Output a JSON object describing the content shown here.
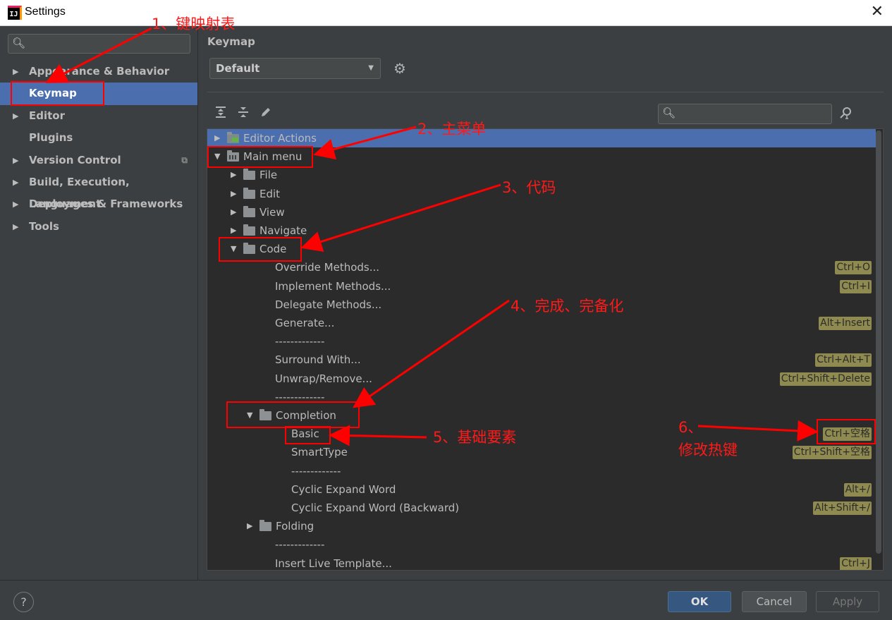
{
  "window": {
    "title": "Settings",
    "close_glyph": "✕",
    "app_icon": "IJ"
  },
  "sidebar": {
    "search_icon": "search-icon",
    "items": [
      {
        "label": "Appearance & Behavior",
        "has_arrow": true
      },
      {
        "label": "Keymap",
        "has_arrow": false,
        "selected": true
      },
      {
        "label": "Editor",
        "has_arrow": true
      },
      {
        "label": "Plugins",
        "has_arrow": false
      },
      {
        "label": "Version Control",
        "has_arrow": true
      },
      {
        "label": "Build, Execution, Deployment",
        "has_arrow": true
      },
      {
        "label": "Languages & Frameworks",
        "has_arrow": true
      },
      {
        "label": "Tools",
        "has_arrow": true
      }
    ]
  },
  "main": {
    "title": "Keymap",
    "keymap_value": "Default"
  },
  "tree": {
    "rows": [
      {
        "label": "Editor Actions",
        "level": 0,
        "expand": "right",
        "icon": "action",
        "selected": true,
        "shortcut": ""
      },
      {
        "label": "Main menu",
        "level": 0,
        "expand": "down",
        "icon": "menu",
        "shortcut": ""
      },
      {
        "label": "File",
        "level": 1,
        "expand": "right",
        "icon": "folder",
        "shortcut": ""
      },
      {
        "label": "Edit",
        "level": 1,
        "expand": "right",
        "icon": "folder",
        "shortcut": ""
      },
      {
        "label": "View",
        "level": 1,
        "expand": "right",
        "icon": "folder",
        "shortcut": ""
      },
      {
        "label": "Navigate",
        "level": 1,
        "expand": "right",
        "icon": "folder",
        "shortcut": ""
      },
      {
        "label": "Code",
        "level": 1,
        "expand": "down",
        "icon": "folder",
        "shortcut": ""
      },
      {
        "label": "Override Methods...",
        "level": 2,
        "expand": "",
        "icon": "",
        "shortcut": "Ctrl+O"
      },
      {
        "label": "Implement Methods...",
        "level": 2,
        "expand": "",
        "icon": "",
        "shortcut": "Ctrl+I"
      },
      {
        "label": "Delegate Methods...",
        "level": 2,
        "expand": "",
        "icon": "",
        "shortcut": ""
      },
      {
        "label": "Generate...",
        "level": 2,
        "expand": "",
        "icon": "",
        "shortcut": "Alt+Insert"
      },
      {
        "label": "-------------",
        "level": 2,
        "expand": "",
        "icon": "",
        "shortcut": ""
      },
      {
        "label": "Surround With...",
        "level": 2,
        "expand": "",
        "icon": "",
        "shortcut": "Ctrl+Alt+T"
      },
      {
        "label": "Unwrap/Remove...",
        "level": 2,
        "expand": "",
        "icon": "",
        "shortcut": "Ctrl+Shift+Delete"
      },
      {
        "label": "-------------",
        "level": 2,
        "expand": "",
        "icon": "",
        "shortcut": ""
      },
      {
        "label": "Completion",
        "level": 2,
        "expand": "down",
        "icon": "folder",
        "shortcut": ""
      },
      {
        "label": "Basic",
        "level": 3,
        "expand": "",
        "icon": "",
        "shortcut": "Ctrl+空格"
      },
      {
        "label": "SmartType",
        "level": 3,
        "expand": "",
        "icon": "",
        "shortcut": "Ctrl+Shift+空格"
      },
      {
        "label": "-------------",
        "level": 3,
        "expand": "",
        "icon": "",
        "shortcut": ""
      },
      {
        "label": "Cyclic Expand Word",
        "level": 3,
        "expand": "",
        "icon": "",
        "shortcut": "Alt+/"
      },
      {
        "label": "Cyclic Expand Word (Backward)",
        "level": 3,
        "expand": "",
        "icon": "",
        "shortcut": "Alt+Shift+/"
      },
      {
        "label": "Folding",
        "level": 2,
        "expand": "right",
        "icon": "folder",
        "shortcut": ""
      },
      {
        "label": "-------------",
        "level": 2,
        "expand": "",
        "icon": "",
        "shortcut": ""
      },
      {
        "label": "Insert Live Template...",
        "level": 2,
        "expand": "",
        "icon": "",
        "shortcut": "Ctrl+J"
      }
    ]
  },
  "footer": {
    "help": "?",
    "ok": "OK",
    "cancel": "Cancel",
    "apply": "Apply"
  },
  "annotations": {
    "n1": "1、键映射表",
    "n2": "2、主菜单",
    "n3": "3、代码",
    "n4": "4、完成、完备化",
    "n5": "5、基础要素",
    "n6a": "6、",
    "n6b": "修改热键"
  },
  "colors": {
    "accent": "#4b6eaf",
    "annotation": "#ff0000",
    "shortcut_bg": "#8f8a4f",
    "ok_button": "#365880"
  }
}
